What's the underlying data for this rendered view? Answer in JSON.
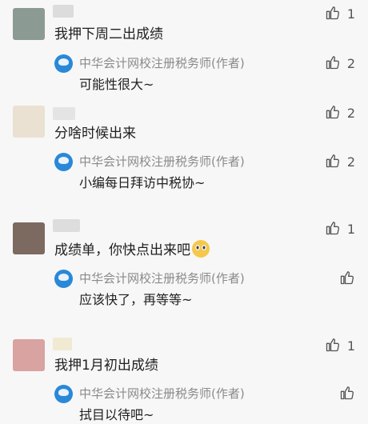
{
  "comments": [
    {
      "avatar_color": "#8c9a94",
      "name_color": "#dcdcdc",
      "text": "我押下周二出成绩",
      "likes": "1",
      "reply": {
        "author": "中华会计网校注册税务师(作者)",
        "text": "可能性很大~",
        "likes": "2"
      }
    },
    {
      "avatar_color": "#eae1d3",
      "name_color": "#e4e4e4",
      "text": "分啥时候出来",
      "likes": "2",
      "reply": {
        "author": "中华会计网校注册税务师(作者)",
        "text": "小编每日拜访中税协~",
        "likes": "2"
      }
    },
    {
      "avatar_color": "#7c6960",
      "name_color": "#dddddd",
      "text": "成绩单，你快点出来吧",
      "likes": "1",
      "emoji": "pleading-face",
      "reply": {
        "author": "中华会计网校注册税务师(作者)",
        "text": "应该快了，再等等~",
        "likes": ""
      }
    },
    {
      "avatar_color": "#d8a3a0",
      "name_color": "#f0ead2",
      "text": "我押1月初出成绩",
      "likes": "1",
      "reply": {
        "author": "中华会计网校注册税务师(作者)",
        "text": "拭目以待吧~",
        "likes": ""
      }
    }
  ]
}
